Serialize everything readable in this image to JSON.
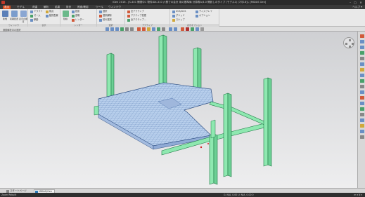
{
  "titlebar": {
    "title": "iGen 2016 - [S-401 開発中1 物件ID4-310  六基での会計 用の基準局 計算書A/4.0 開設しのタイプ (モデル1) (7月18)]- [MIDAS Gen]",
    "minimize": "–",
    "maximize": "□",
    "close": "✕"
  },
  "menubar": {
    "items": [
      "表示",
      "モデル",
      "荷重",
      "解析",
      "結果",
      "設計",
      "照査/確認",
      "ツール",
      "ウィンドウ"
    ],
    "active_index": 0,
    "help": "ヘルプ ▾"
  },
  "ribbon": {
    "groups": [
      {
        "label": "ウィンドウ"
      },
      {
        "label": "表示"
      },
      {
        "label": "レンダー"
      },
      {
        "label": "選択"
      },
      {
        "label": "アクティブ"
      },
      {
        "label": "表示オプション"
      }
    ],
    "window_buttons": [
      "新規",
      "初期配置",
      "表示の順序"
    ],
    "view_buttons": [
      "ドラフト",
      "ズーム",
      "移動",
      "視点",
      "動的配置"
    ],
    "render_buttons": [
      "隠線",
      "投影",
      "透明",
      "レンダー"
    ],
    "select_buttons": [
      "選択",
      "選択解除",
      "前の選択"
    ],
    "active_buttons": [
      "全アクティブ",
      "アクティブ変更",
      "全アクティブ..."
    ],
    "display_buttons": [
      "UCS/GCS",
      "グリッド",
      "スナップ",
      "ディスプレイ",
      "オプション"
    ],
    "sheet_label": "運動解析中の選択"
  },
  "tabs": [
    {
      "label": "スタートページ"
    },
    {
      "label": "MIDAS/Gen"
    }
  ],
  "statusbar": {
    "left": "Zoom Rebuilt",
    "coords": "G: N/A, 0.00  U: N/A, 0.00  0",
    "right": "m  ▾  N  ▾"
  },
  "colors": {
    "accent": "#d94f1f",
    "member_fill": "#8ee8b0",
    "member_stroke": "#1e7a45",
    "slab_fill": "#b8cfec",
    "slab_grid": "#4a6fa8",
    "viewport_top": "#cfd0d3",
    "viewport_bottom": "#eeeeef"
  }
}
